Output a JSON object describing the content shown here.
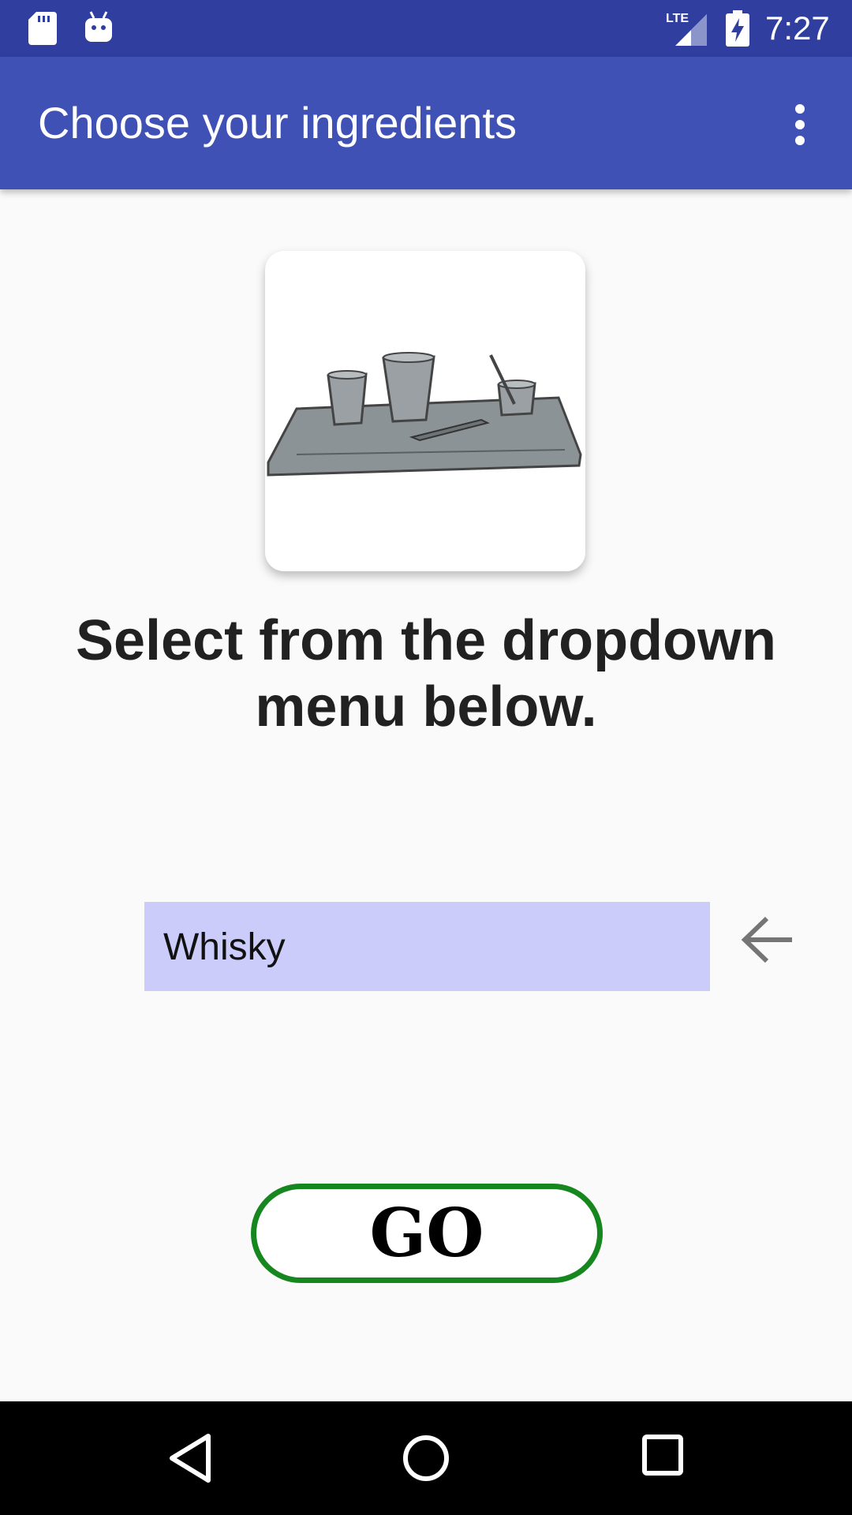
{
  "status_bar": {
    "time": "7:27",
    "network": "LTE",
    "icons": [
      "sd-card-icon",
      "android-debug-icon",
      "lte-signal-icon",
      "battery-charging-icon"
    ],
    "background": "#303f9f"
  },
  "app_bar": {
    "title": "Choose your ingredients",
    "menu_icon": "more-vert-icon",
    "background": "#3f51b5"
  },
  "main": {
    "image": "bar-tray-with-cups-illustration",
    "instruction": "Select from the dropdown menu below.",
    "dropdown": {
      "selected": "Whisky",
      "background": "#ccccfb"
    },
    "back_icon": "arrow-back-icon",
    "go_button": {
      "label": "GO",
      "border_color": "#16861f"
    }
  },
  "nav_bar": {
    "icons": [
      "nav-back-icon",
      "nav-home-icon",
      "nav-recents-icon"
    ]
  }
}
